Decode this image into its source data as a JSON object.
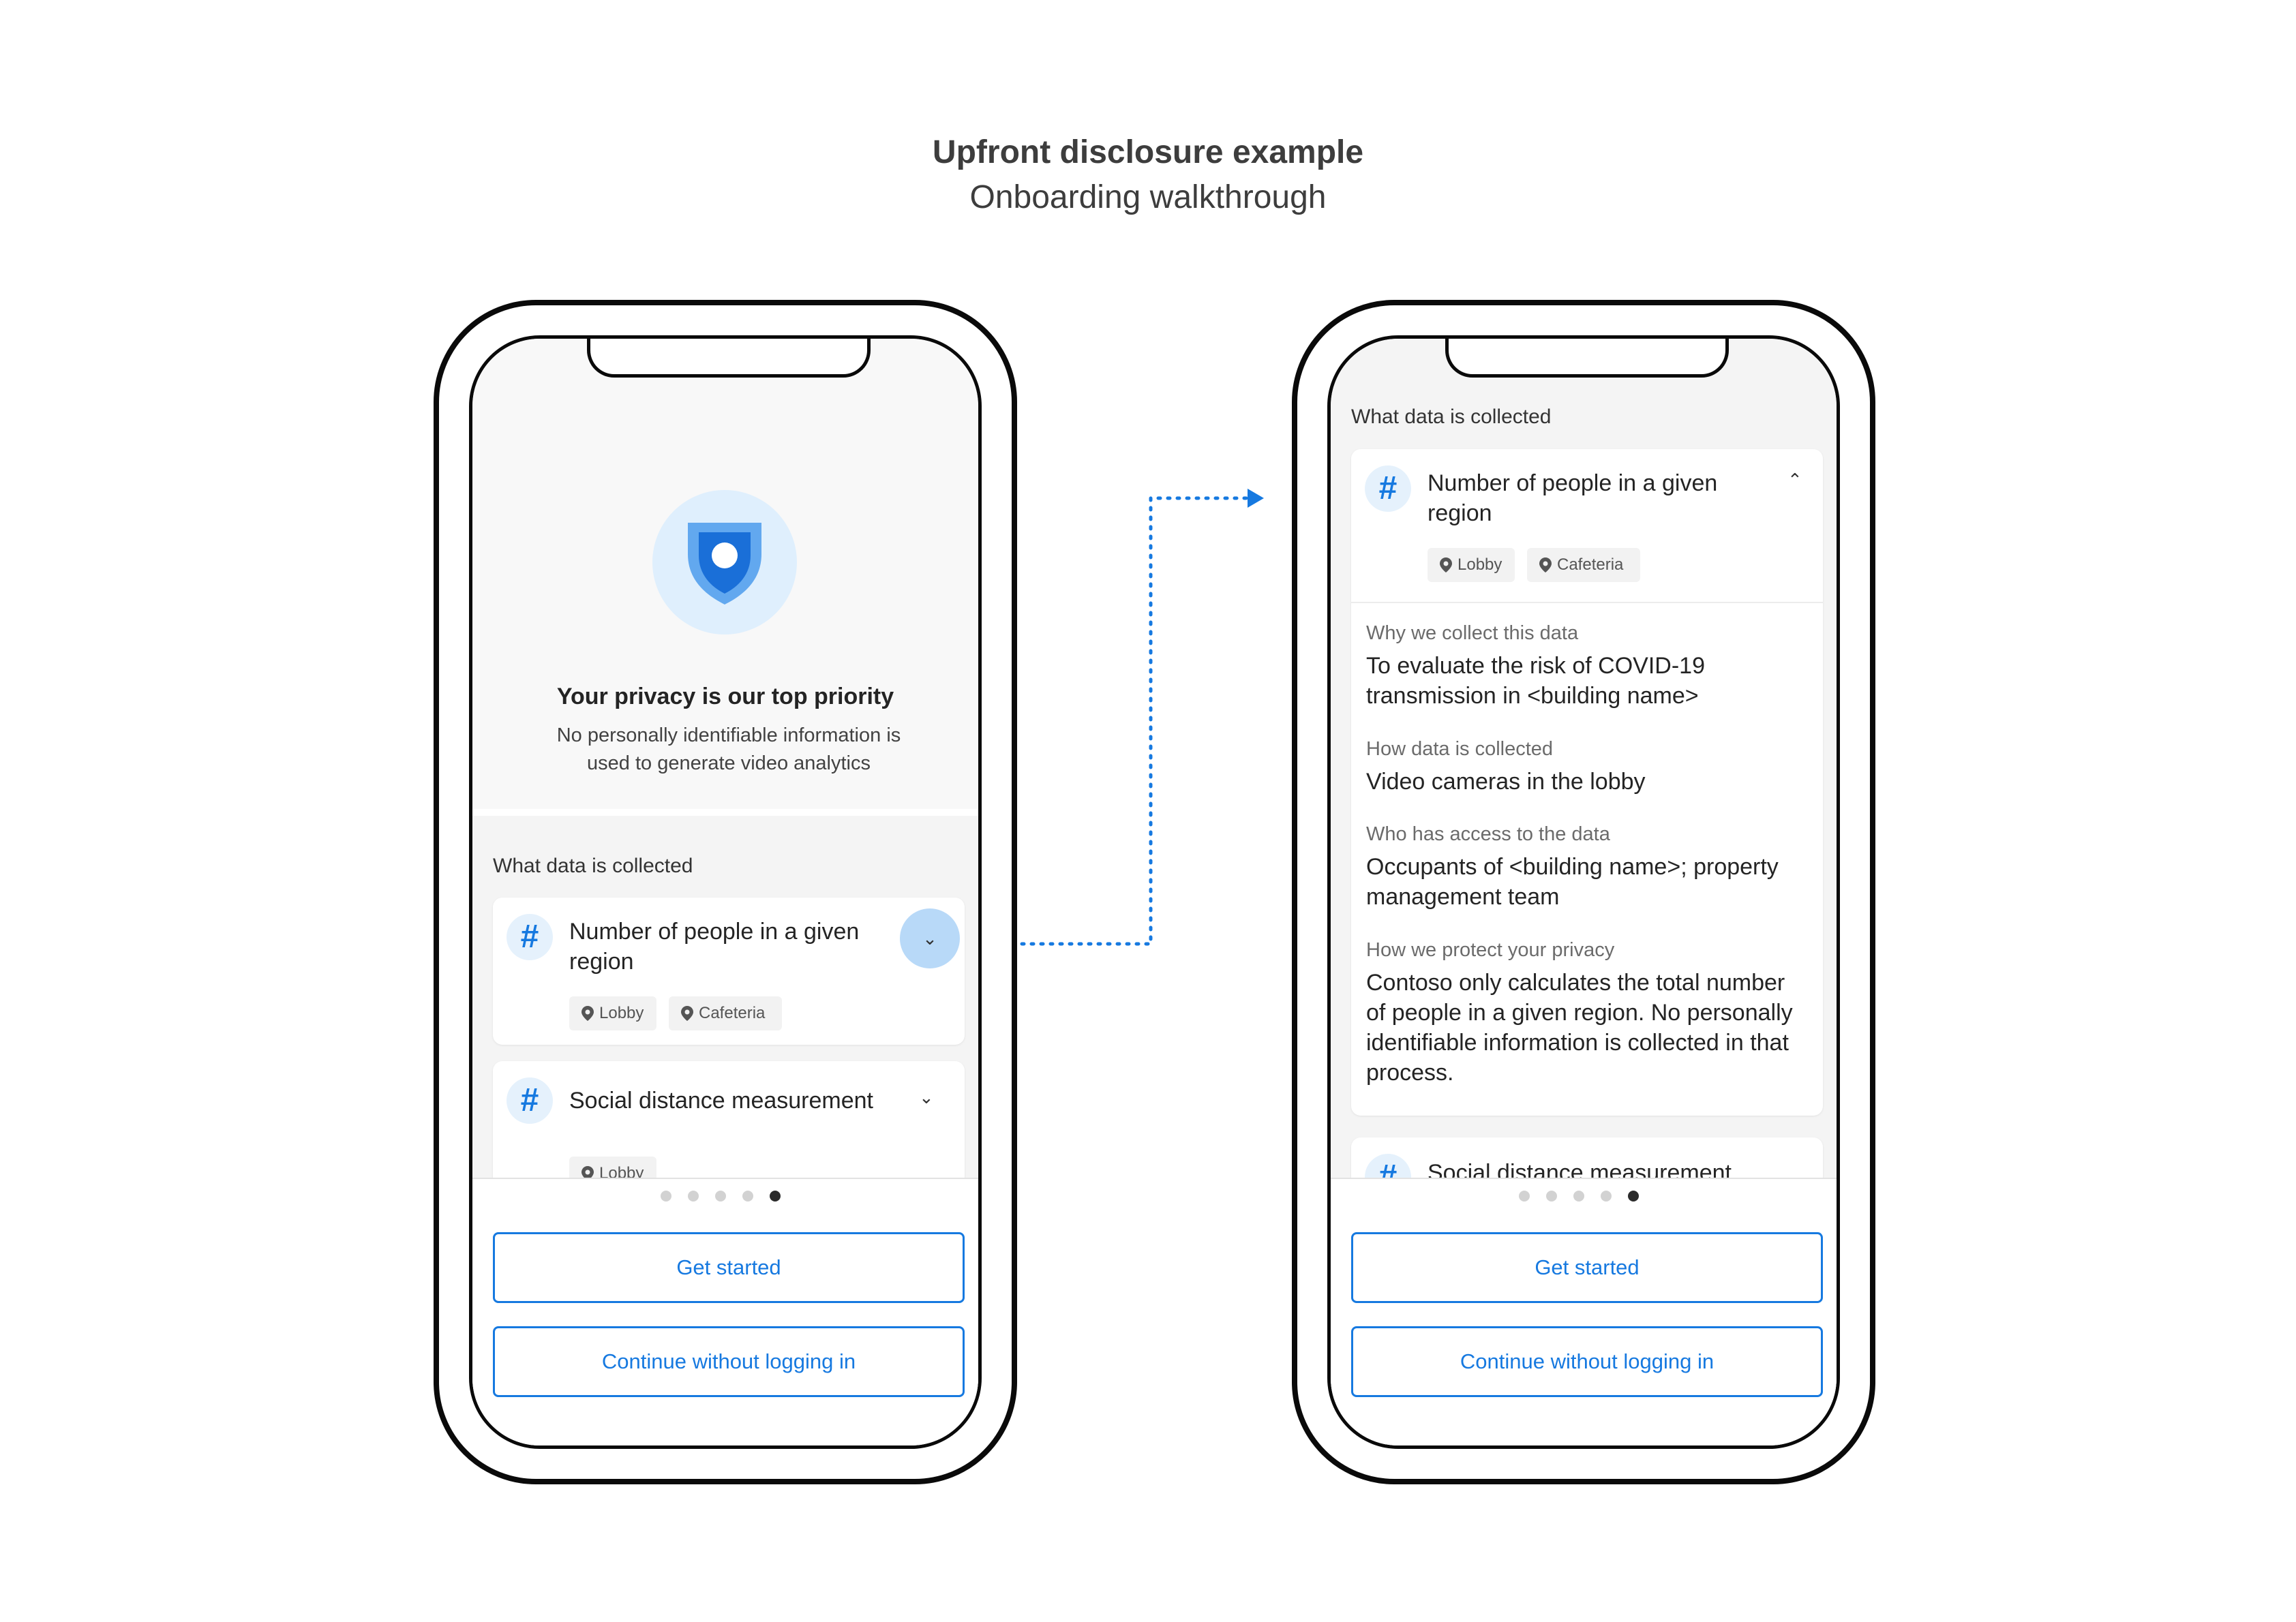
{
  "heading": {
    "title": "Upfront disclosure example",
    "subtitle": "Onboarding walkthrough"
  },
  "colors": {
    "accent": "#1679e0",
    "chevron_highlight": "#b8d9f8",
    "icon_bg": "#e5f1fc"
  },
  "left_phone": {
    "shield_icon": "shield-icon",
    "privacy_title": "Your privacy is our top priority",
    "privacy_desc": "No personally identifiable information is used to generate video analytics",
    "section_label": "What data is collected",
    "card1": {
      "icon": "hash-icon",
      "title": "Number of people in a given region",
      "chips": [
        "Lobby",
        "Cafeteria"
      ]
    },
    "card2": {
      "icon": "hash-icon",
      "title": "Social distance measurement",
      "chips": [
        "Lobby"
      ]
    },
    "pager": {
      "count": 5,
      "active_index": 4
    },
    "get_started": "Get started",
    "continue": "Continue without logging in"
  },
  "right_phone": {
    "section_label": "What data is collected",
    "card1": {
      "icon": "hash-icon",
      "title": "Number of people in a given region",
      "chips": [
        "Lobby",
        "Cafeteria"
      ],
      "details": [
        {
          "label": "Why we collect this data",
          "value": "To evaluate the risk of COVID-19 transmission in <building name>"
        },
        {
          "label": "How data is collected",
          "value": "Video cameras in the lobby"
        },
        {
          "label": "Who has access to the data",
          "value": "Occupants of <building name>; property management team"
        },
        {
          "label": "How we protect your privacy",
          "value": "Contoso only calculates the total number of people in a given region. No personally identifiable information is collected in that process."
        }
      ]
    },
    "card2": {
      "icon": "hash-icon",
      "title": "Social distance measurement"
    },
    "pager": {
      "count": 5,
      "active_index": 4
    },
    "get_started": "Get started",
    "continue": "Continue without logging in"
  }
}
